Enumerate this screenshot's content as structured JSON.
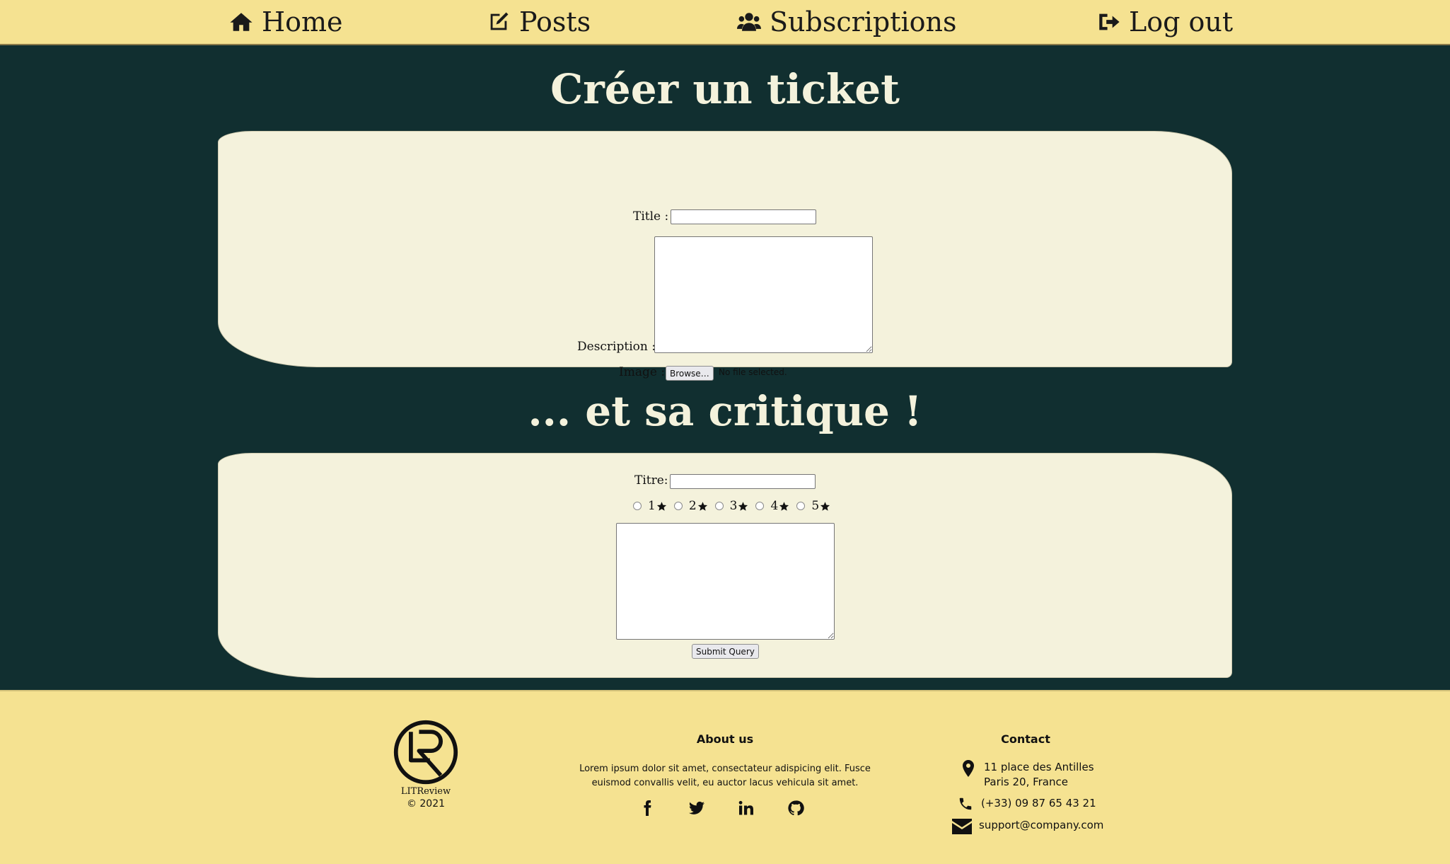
{
  "nav": {
    "home": "Home",
    "posts": "Posts",
    "subscriptions": "Subscriptions",
    "logout": "Log out"
  },
  "ticket": {
    "heading": "Créer un ticket",
    "title_label": "Title :",
    "title_value": "",
    "description_label": "Description :",
    "description_value": "",
    "image_label": "Image :",
    "browse_button": "Browse…",
    "file_status": "No file selected."
  },
  "review": {
    "heading": "... et sa critique !",
    "title_label": "Titre:",
    "title_value": "",
    "rating_options": [
      "1",
      "2",
      "3",
      "4",
      "5"
    ],
    "body_value": "",
    "submit_button": "Submit Query"
  },
  "footer": {
    "logo_name": "LITReview",
    "copyright": "© 2021",
    "about_heading": "About us",
    "about_text": "Lorem ipsum dolor sit amet, consectateur adispicing elit. Fusce euismod convallis velit, eu auctor lacus vehicula sit amet.",
    "socials": [
      "facebook-icon",
      "twitter-icon",
      "linkedin-icon",
      "github-icon"
    ],
    "contact_heading": "Contact",
    "address_line1": "11 place des Antilles",
    "address_line2": "Paris 20, France",
    "phone": "(+33) 09 87 65 43 21",
    "email": "support@company.com"
  },
  "colors": {
    "nav_bg": "#f5e291",
    "main_bg": "#112f30",
    "card_bg": "#f4f2dc",
    "heading_text": "#f4f2dc"
  }
}
